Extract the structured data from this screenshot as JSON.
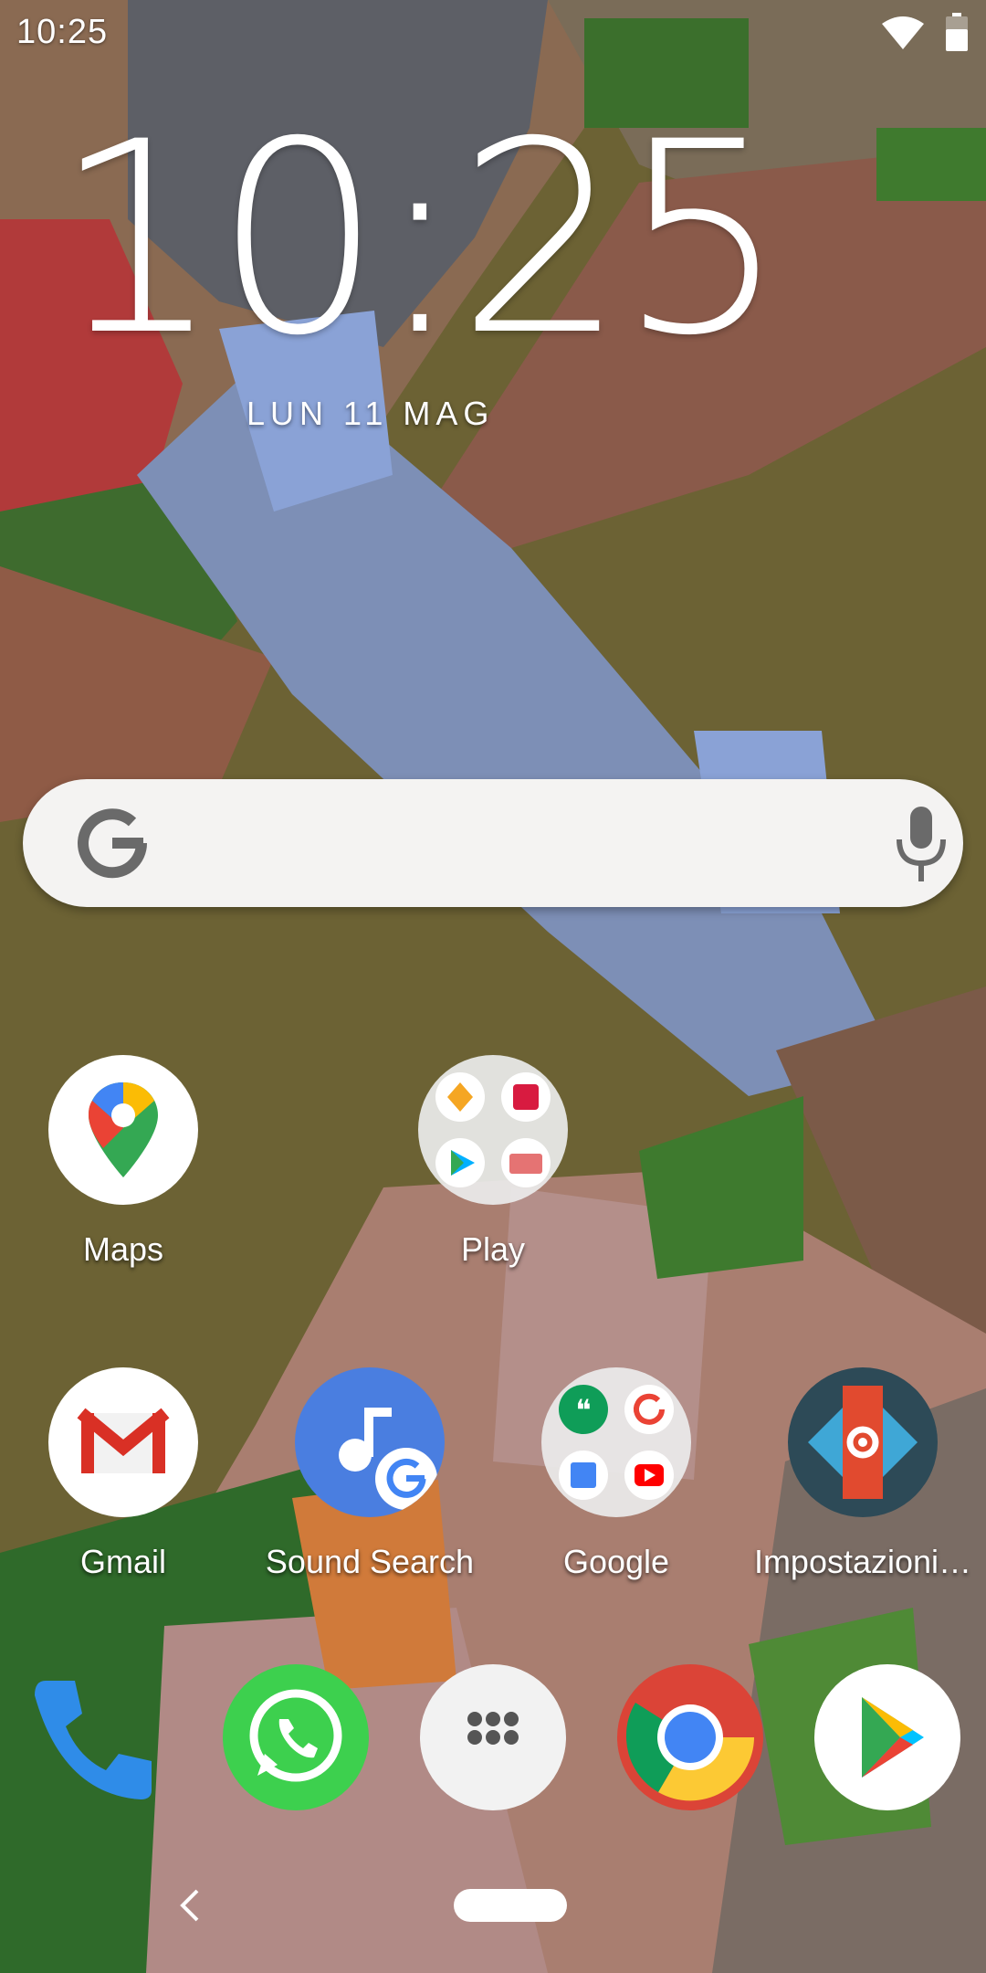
{
  "status_bar": {
    "time": "10:25",
    "icons": [
      "wifi-icon",
      "battery-icon"
    ]
  },
  "lock_clock": {
    "time": "10:25",
    "date": "LUN 11 MAG"
  },
  "search": {
    "left_icon": "google-g-icon",
    "right_icon": "mic-icon"
  },
  "apps": {
    "maps": {
      "label": "Maps",
      "icon": "google-maps-icon"
    },
    "play": {
      "label": "Play",
      "icon": "play-folder-icon"
    },
    "gmail": {
      "label": "Gmail",
      "icon": "gmail-icon"
    },
    "sound_search": {
      "label": "Sound Search",
      "icon": "sound-search-icon"
    },
    "google": {
      "label": "Google",
      "icon": "google-folder-icon"
    },
    "settings": {
      "label": "Impostazioni…",
      "icon": "nova-settings-icon"
    }
  },
  "dock": [
    "phone-icon",
    "whatsapp-icon",
    "app-drawer-icon",
    "chrome-icon",
    "play-store-icon"
  ],
  "navigation": [
    "back-icon",
    "home-pill"
  ],
  "colors": {
    "searchbar_bg": "#f4f3f2",
    "google_blue": "#4285f4",
    "google_red": "#ea4335",
    "google_yellow": "#fbbc05",
    "google_green": "#34a853",
    "whatsapp_green": "#3dd04e"
  }
}
